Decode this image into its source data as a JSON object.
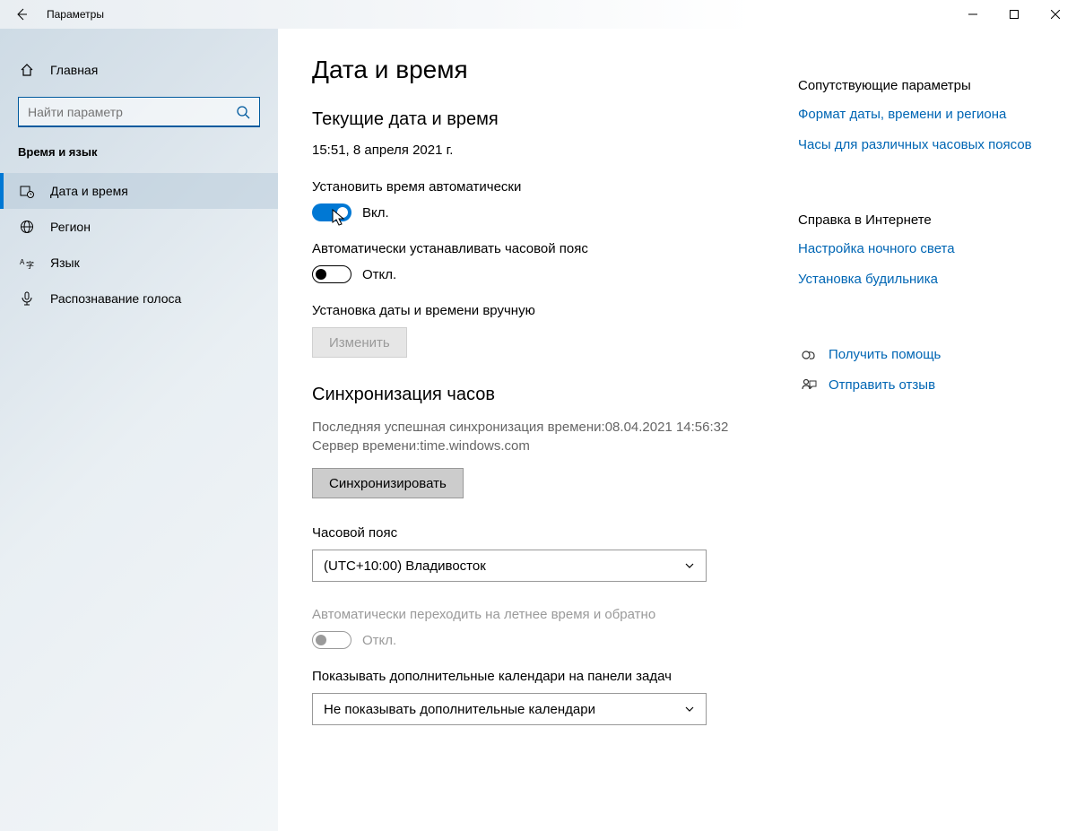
{
  "window": {
    "title": "Параметры"
  },
  "sidebar": {
    "home": "Главная",
    "search_placeholder": "Найти параметр",
    "category": "Время и язык",
    "items": [
      {
        "label": "Дата и время"
      },
      {
        "label": "Регион"
      },
      {
        "label": "Язык"
      },
      {
        "label": "Распознавание голоса"
      }
    ]
  },
  "main": {
    "title": "Дата и время",
    "current_section": "Текущие дата и время",
    "current_value": "15:51, 8 апреля 2021 г.",
    "auto_time_label": "Установить время автоматически",
    "auto_time_state": "Вкл.",
    "auto_tz_label": "Автоматически устанавливать часовой пояс",
    "auto_tz_state": "Откл.",
    "manual_label": "Установка даты и времени вручную",
    "change_btn": "Изменить",
    "sync_section": "Синхронизация часов",
    "sync_info_line1": "Последняя успешная синхронизация времени:08.04.2021 14:56:32",
    "sync_info_line2": "Сервер времени:time.windows.com",
    "sync_btn": "Синхронизировать",
    "tz_label": "Часовой пояс",
    "tz_value": "(UTC+10:00) Владивосток",
    "dst_label": "Автоматически переходить на летнее время и обратно",
    "dst_state": "Откл.",
    "cal_label": "Показывать дополнительные календари на панели задач",
    "cal_value": "Не показывать дополнительные календари"
  },
  "right": {
    "related_heading": "Сопутствующие параметры",
    "link_format": "Формат даты, времени и региона",
    "link_clocks": "Часы для различных часовых поясов",
    "help_heading": "Справка в Интернете",
    "link_nightlight": "Настройка ночного света",
    "link_alarm": "Установка будильника",
    "get_help": "Получить помощь",
    "feedback": "Отправить отзыв"
  }
}
